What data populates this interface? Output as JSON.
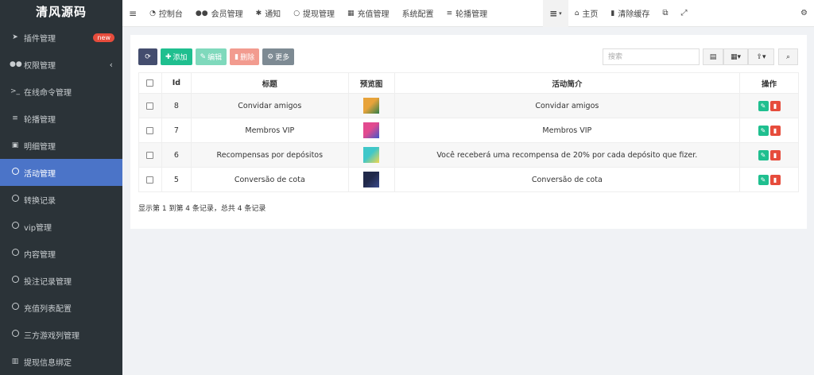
{
  "brand": {
    "title": "清风源码"
  },
  "sidebar": {
    "items": [
      {
        "label": "插件管理",
        "icon": "rocket-icon",
        "badge": "new"
      },
      {
        "label": "权限管理",
        "icon": "users-icon",
        "chevron": "‹"
      },
      {
        "label": "在线命令管理",
        "icon": "terminal-icon"
      },
      {
        "label": "轮播管理",
        "icon": "list-icon"
      },
      {
        "label": "明细管理",
        "icon": "calendar-icon"
      },
      {
        "label": "活动管理",
        "icon": "circle-icon",
        "active": true
      },
      {
        "label": "转换记录",
        "icon": "circle-icon"
      },
      {
        "label": "vip管理",
        "icon": "circle-icon"
      },
      {
        "label": "内容管理",
        "icon": "circle-icon"
      },
      {
        "label": "投注记录管理",
        "icon": "circle-icon"
      },
      {
        "label": "充值列表配置",
        "icon": "circle-icon"
      },
      {
        "label": "三方游戏列管理",
        "icon": "circle-icon"
      },
      {
        "label": "提现信息绑定",
        "icon": "bank-icon"
      }
    ]
  },
  "topbar": {
    "items": [
      {
        "label": "控制台",
        "icon": "dashboard-icon"
      },
      {
        "label": "会员管理",
        "icon": "users-icon"
      },
      {
        "label": "通知",
        "icon": "asterisk-icon"
      },
      {
        "label": "提现管理",
        "icon": "circle-icon"
      },
      {
        "label": "充值管理",
        "icon": "grid-icon"
      },
      {
        "label": "系统配置",
        "icon": ""
      },
      {
        "label": "轮播管理",
        "icon": "list-icon"
      }
    ],
    "right": {
      "home": "主页",
      "clear_cache": "清除缓存"
    }
  },
  "toolbar": {
    "add": "添加",
    "edit": "编辑",
    "delete": "删除",
    "more": "更多"
  },
  "search": {
    "placeholder": "搜索"
  },
  "table": {
    "columns": [
      "Id",
      "标题",
      "预览图",
      "活动简介",
      "操作"
    ],
    "rows": [
      {
        "id": "8",
        "title": "Convidar amigos",
        "summary": "Convidar amigos",
        "thumb_colors": [
          "#e8a33a",
          "#2f7f4a"
        ]
      },
      {
        "id": "7",
        "title": "Membros VIP",
        "summary": "Membros VIP",
        "thumb_colors": [
          "#e24a8f",
          "#4057c9"
        ]
      },
      {
        "id": "6",
        "title": "Recompensas por depósitos",
        "summary": "Você receberá uma recompensa de 20% por cada depósito que fizer.",
        "thumb_colors": [
          "#3fc7c9",
          "#f2d64b"
        ]
      },
      {
        "id": "5",
        "title": "Conversão de cota",
        "summary": "Conversão de cota",
        "thumb_colors": [
          "#21294a",
          "#3a4a8a"
        ]
      }
    ]
  },
  "pager": {
    "text": "显示第 1 到第 4 条记录，总共 4 条记录"
  },
  "colors": {
    "sidebar_bg": "#2b3338",
    "sidebar_active": "#4b74c8",
    "green": "#1fbf8f",
    "red": "#e64c3c"
  }
}
